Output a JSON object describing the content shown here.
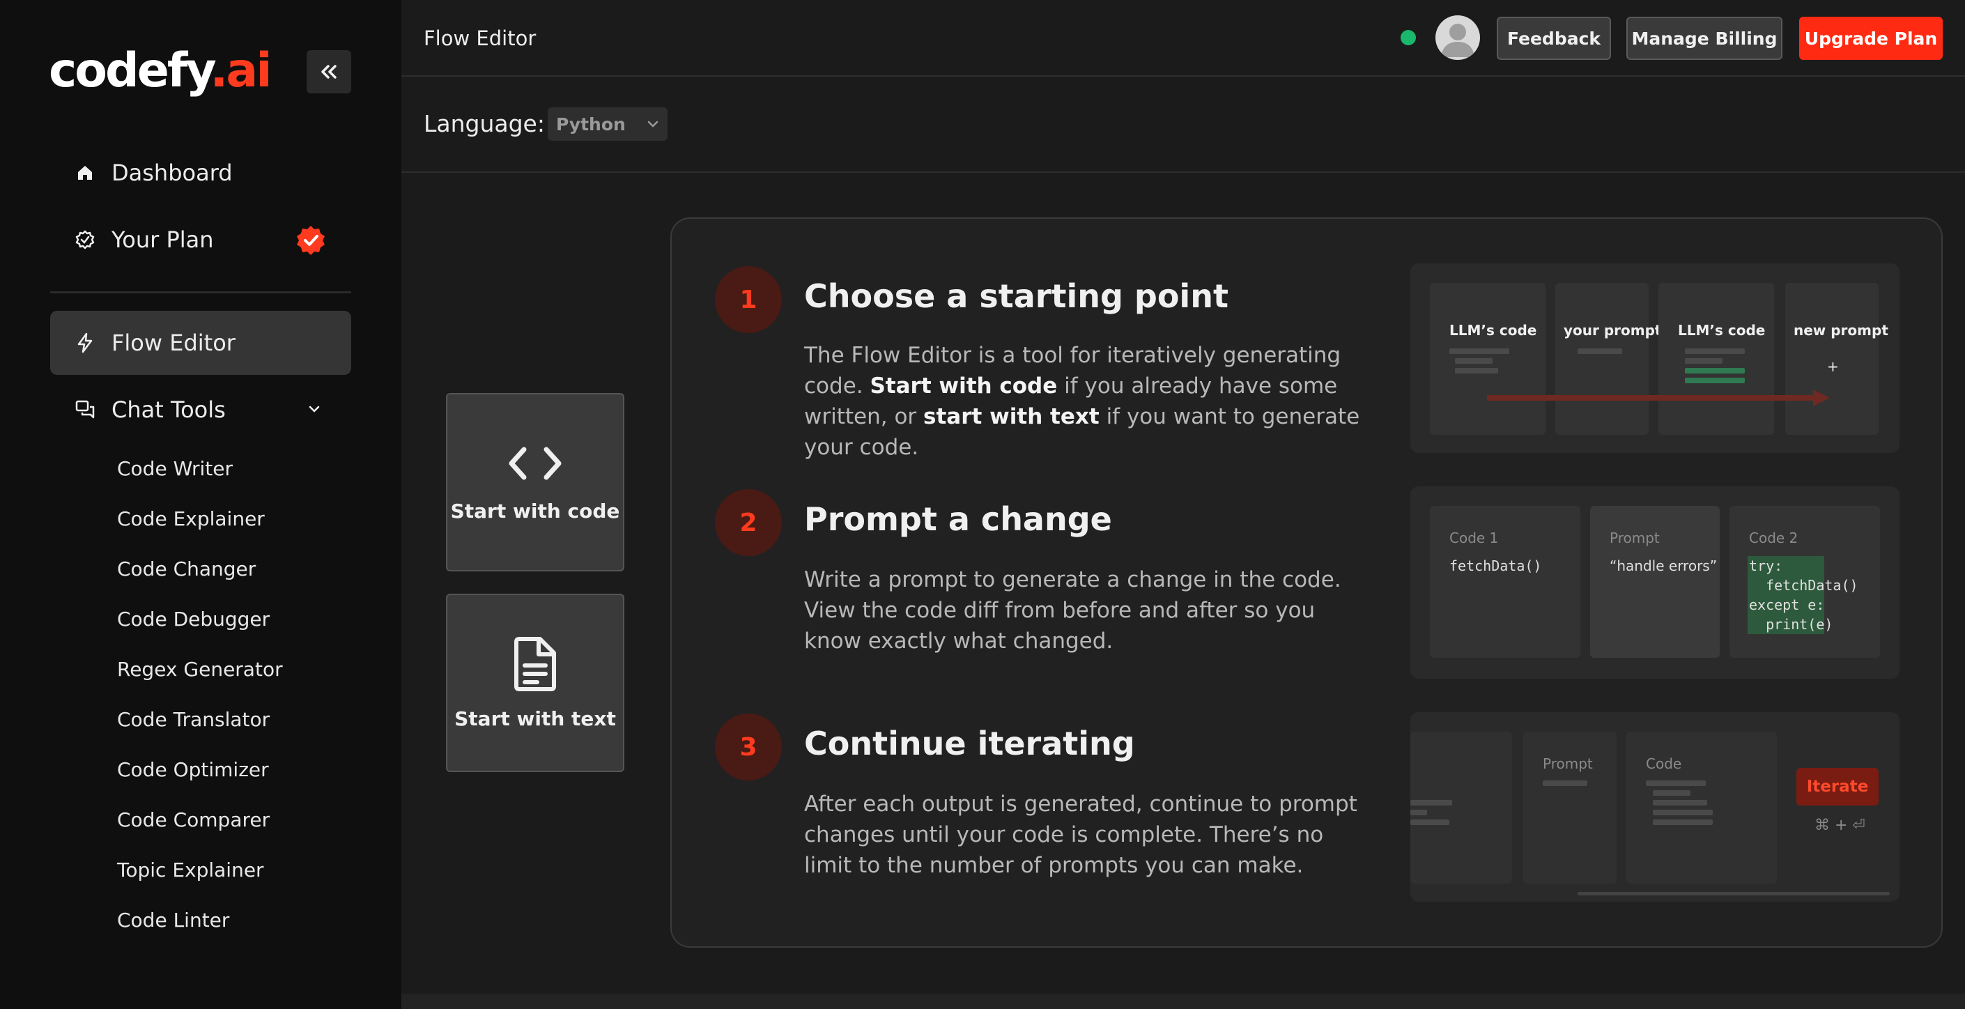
{
  "app": {
    "logo_main": "codefy",
    "logo_accent": ".ai",
    "accent_color": "#ff3b1f"
  },
  "sidebar": {
    "nav": [
      {
        "label": "Dashboard",
        "icon": "home-icon"
      },
      {
        "label": "Your Plan",
        "icon": "settings-badge-icon",
        "badge_icon": "verified-badge-icon"
      },
      {
        "label": "Flow Editor",
        "icon": "lightning-icon",
        "active": true
      },
      {
        "label": "Chat Tools",
        "icon": "chat-icon",
        "expanded": true
      }
    ],
    "chat_tools": [
      "Code Writer",
      "Code Explainer",
      "Code Changer",
      "Code Debugger",
      "Regex Generator",
      "Code Translator",
      "Code Optimizer",
      "Code Comparer",
      "Topic Explainer",
      "Code Linter"
    ]
  },
  "header": {
    "title": "Flow Editor",
    "status_color": "#19b86d",
    "buttons": {
      "feedback": "Feedback",
      "billing": "Manage Billing",
      "upgrade": "Upgrade Plan"
    }
  },
  "language": {
    "label": "Language:",
    "selected": "Python"
  },
  "start": {
    "code_label": "Start with code",
    "text_label": "Start with text"
  },
  "steps": [
    {
      "num": "1",
      "title": "Choose a starting point",
      "desc_1": "The Flow Editor is a tool for iteratively generating code. ",
      "desc_b1": "Start with code",
      "desc_2": " if you already have some written, or ",
      "desc_b2": "start with text",
      "desc_3": " if you want to generate your code."
    },
    {
      "num": "2",
      "title": "Prompt a change",
      "desc": "Write a prompt to generate a change in the code. View the code diff from before and after so you know exactly what changed."
    },
    {
      "num": "3",
      "title": "Continue iterating",
      "desc": "After each output is generated, continue to prompt changes until your code is complete. There’s no limit to the number of prompts you can make."
    }
  ],
  "illus1": {
    "cols": [
      "LLM’s code",
      "your prompt",
      "LLM’s code",
      "new prompt"
    ],
    "plus": "+"
  },
  "illus2": {
    "code1_header": "Code 1",
    "code1": "fetchData()",
    "prompt_header": "Prompt",
    "prompt": "“handle errors”",
    "code2_header": "Code 2",
    "code2_lines": [
      "try:",
      "  fetchData()",
      "except e:",
      "  print(e)"
    ]
  },
  "illus3": {
    "prompt_header": "Prompt",
    "code_header": "Code",
    "iterate_label": "Iterate",
    "shortcut": "⌘ + ⏎"
  }
}
